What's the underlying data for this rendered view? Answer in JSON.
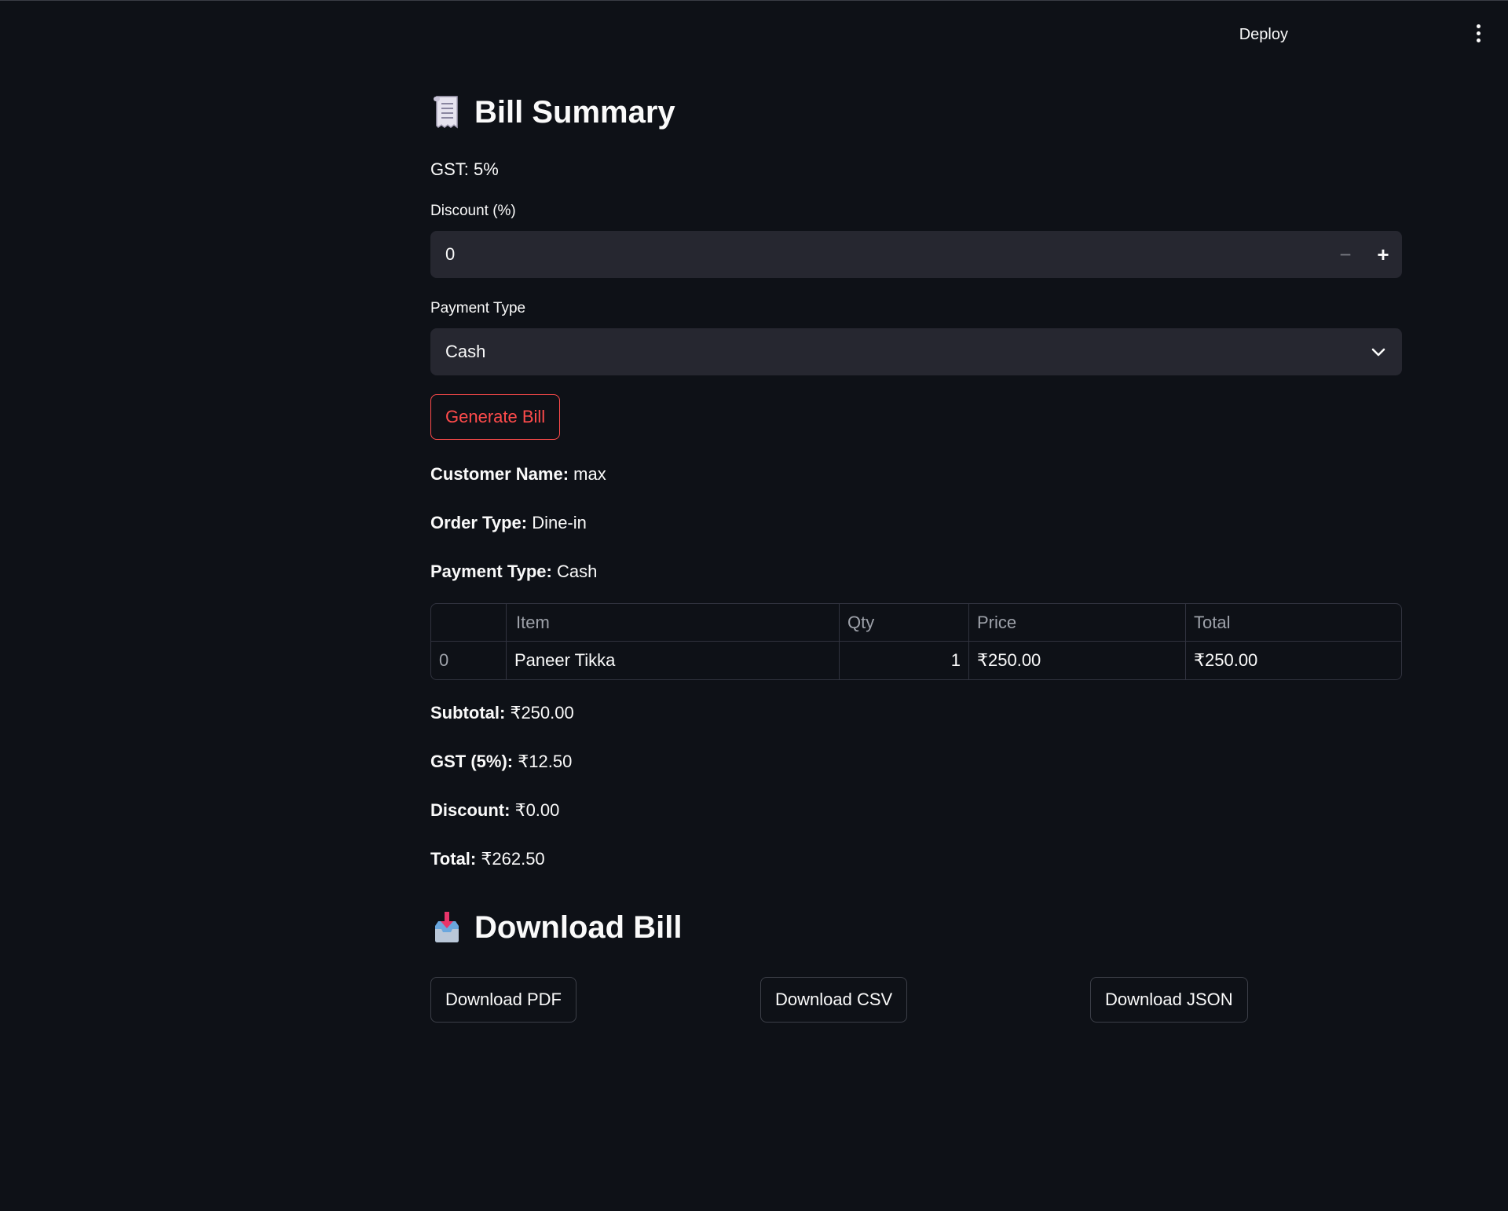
{
  "header": {
    "deploy_label": "Deploy",
    "menu_icon": "kebab-menu-icon"
  },
  "bill_summary": {
    "title": "Bill Summary",
    "title_icon": "receipt-icon",
    "gst_text": "GST: 5%"
  },
  "discount": {
    "label": "Discount (%)",
    "value": "0",
    "minus_symbol": "−",
    "plus_symbol": "+"
  },
  "payment": {
    "label": "Payment Type",
    "selected": "Cash"
  },
  "generate_button": "Generate Bill",
  "details": {
    "customer_label": "Customer Name:",
    "customer_value": "max",
    "order_label": "Order Type:",
    "order_value": "Dine-in",
    "payment_label": "Payment Type:",
    "payment_value": "Cash"
  },
  "table": {
    "headers": [
      "",
      "Item",
      "Qty",
      "Price",
      "Total"
    ],
    "rows": [
      {
        "index": "0",
        "item": "Paneer Tikka",
        "qty": "1",
        "price": "₹250.00",
        "total": "₹250.00"
      }
    ]
  },
  "totals": {
    "subtotal_label": "Subtotal:",
    "subtotal_value": "₹250.00",
    "gst_label": "GST (5%):",
    "gst_value": "₹12.50",
    "discount_label": "Discount:",
    "discount_value": "₹0.00",
    "total_label": "Total:",
    "total_value": "₹262.50"
  },
  "download": {
    "title": "Download Bill",
    "title_icon": "inbox-tray-icon",
    "pdf_label": "Download PDF",
    "csv_label": "Download CSV",
    "json_label": "Download JSON"
  },
  "colors": {
    "background": "#0e1117",
    "input_bg": "#262730",
    "accent": "#ff4b4b"
  }
}
